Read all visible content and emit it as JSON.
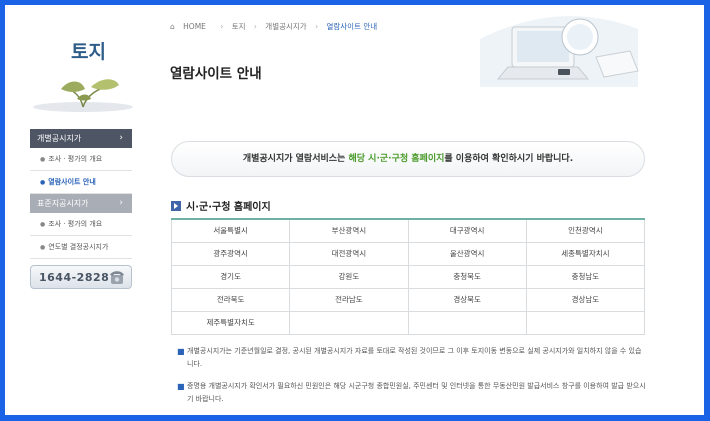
{
  "sidebar": {
    "title": "토지",
    "menu1": {
      "label": "개별공시지가",
      "chev": "›"
    },
    "menu1_items": [
      "조사 · 평가의 개요",
      "열람사이트 안내"
    ],
    "menu2": {
      "label": "표준지공시지가",
      "chev": "›"
    },
    "menu2_items": [
      "조사 · 평가의 개요",
      "연도별 결정공시지가"
    ],
    "phone": "1644-2828"
  },
  "breadcrumb": {
    "home": "HOME",
    "sep": "›",
    "items": [
      "토지",
      "개별공시지가",
      "열람사이트 안내"
    ]
  },
  "page_title": "열람사이트 안내",
  "notice": {
    "before": "개별공시지가 열람서비스는 ",
    "highlight": "해당 시·군·구청 홈페이지",
    "after": "를 이용하여 확인하시기 바랍니다."
  },
  "section_title": "시·군·구청 홈페이지",
  "regions": [
    [
      "서울특별시",
      "부산광역시",
      "대구광역시",
      "인천광역시"
    ],
    [
      "광주광역시",
      "대전광역시",
      "울산광역시",
      "세종특별자치시"
    ],
    [
      "경기도",
      "강원도",
      "충청북도",
      "충청남도"
    ],
    [
      "전라북도",
      "전라남도",
      "경상북도",
      "경상남도"
    ],
    [
      "제주특별자치도",
      "",
      "",
      ""
    ]
  ],
  "notes": [
    "개별공시지가는 기준년월일로 결정, 공시된 개별공시지가 자료를 토대로 작성된 것이므로 그 이후 토지이동 변동으로 실제 공시지가와 일치하지 않을 수 있습니다.",
    "증명용 개별공시지가 확인서가 필요하신 민원인은 해당 시군구청 종합민원실, 주민센터 및 인터넷을 통한 무동산민원 발급서비스 창구를 이용하여 발급 받으시기 바랍니다."
  ],
  "colors": {
    "frame": "#1a63e6",
    "accent": "#2a63b8",
    "highlight": "#4a9b2b",
    "table_top": "#6fb0a6"
  }
}
